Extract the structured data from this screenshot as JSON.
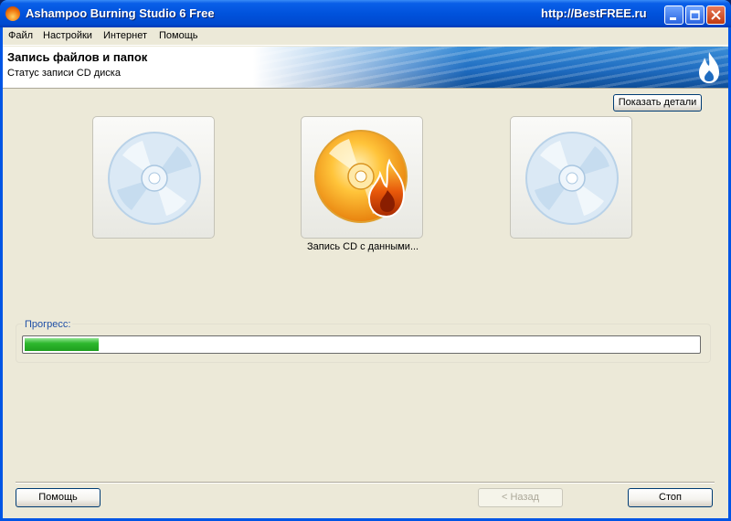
{
  "window": {
    "title": "Ashampoo Burning Studio 6 Free",
    "watermark": "http://BestFREE.ru"
  },
  "menu": [
    "Файл",
    "Настройки",
    "Интернет",
    "Помощь"
  ],
  "header": {
    "title": "Запись файлов и папок",
    "subtitle": "Статус записи CD диска"
  },
  "buttons": {
    "details": "Показать детали",
    "help": "Помощь",
    "back": "< Назад",
    "stop": "Стоп"
  },
  "steps": {
    "active_caption": "Запись CD с данными..."
  },
  "progress": {
    "label": "Прогресс:",
    "fraction": 0.11
  },
  "colors": {
    "progress": "#2eb82e",
    "accent": "#0055e5"
  },
  "icons": [
    "app-icon",
    "minimize-icon",
    "maximize-icon",
    "close-icon",
    "disc-icon",
    "burning-disc-icon",
    "flame-logo-icon"
  ]
}
